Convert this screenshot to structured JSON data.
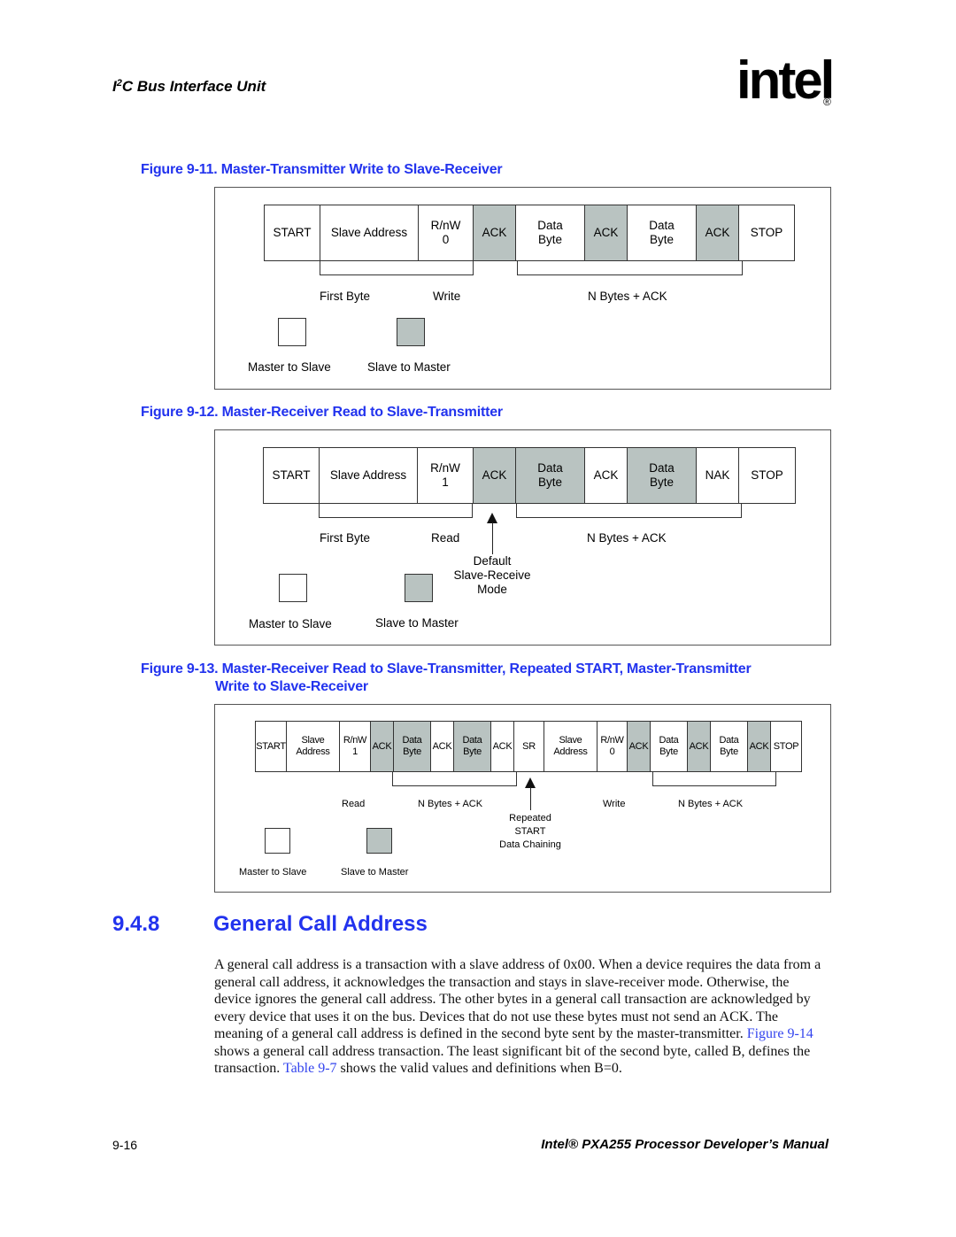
{
  "header": {
    "section_prefix": "I",
    "section_sup": "2",
    "section_suffix": "C Bus Interface Unit",
    "logo_text": "intel",
    "logo_registered": "®"
  },
  "figures": [
    {
      "caption": "Figure 9-11. Master-Transmitter Write to Slave-Receiver",
      "cells": [
        {
          "text": "START",
          "shaded": false
        },
        {
          "text": "Slave Address",
          "shaded": false
        },
        {
          "text": "R/nW\n0",
          "shaded": false
        },
        {
          "text": "ACK",
          "shaded": true
        },
        {
          "text": "Data\nByte",
          "shaded": false
        },
        {
          "text": "ACK",
          "shaded": true
        },
        {
          "text": "Data\nByte",
          "shaded": false
        },
        {
          "text": "ACK",
          "shaded": true
        },
        {
          "text": "STOP",
          "shaded": false
        }
      ],
      "labels": [
        "First Byte",
        "Write",
        "N Bytes + ACK"
      ],
      "legend": [
        "Master to Slave",
        "Slave to Master"
      ]
    },
    {
      "caption": "Figure 9-12. Master-Receiver Read to Slave-Transmitter",
      "cells": [
        {
          "text": "START",
          "shaded": false
        },
        {
          "text": "Slave Address",
          "shaded": false
        },
        {
          "text": "R/nW\n1",
          "shaded": false
        },
        {
          "text": "ACK",
          "shaded": true
        },
        {
          "text": "Data\nByte",
          "shaded": true
        },
        {
          "text": "ACK",
          "shaded": false
        },
        {
          "text": "Data\nByte",
          "shaded": true
        },
        {
          "text": "NAK",
          "shaded": false
        },
        {
          "text": "STOP",
          "shaded": false
        }
      ],
      "labels": [
        "First Byte",
        "Read",
        "N Bytes + ACK"
      ],
      "annotation": "Default\nSlave-Receive\nMode",
      "legend": [
        "Master to Slave",
        "Slave to Master"
      ]
    },
    {
      "caption_line1": "Figure 9-13. Master-Receiver Read to Slave-Transmitter, Repeated START, Master-Transmitter",
      "caption_line2": "Write to Slave-Receiver",
      "cells": [
        {
          "text": "START",
          "shaded": false
        },
        {
          "text": "Slave\nAddress",
          "shaded": false
        },
        {
          "text": "R/nW\n1",
          "shaded": false
        },
        {
          "text": "ACK",
          "shaded": true
        },
        {
          "text": "Data\nByte",
          "shaded": true
        },
        {
          "text": "ACK",
          "shaded": false
        },
        {
          "text": "Data\nByte",
          "shaded": true
        },
        {
          "text": "ACK",
          "shaded": false
        },
        {
          "text": "SR",
          "shaded": false
        },
        {
          "text": "Slave\nAddress",
          "shaded": false
        },
        {
          "text": "R/nW\n0",
          "shaded": false
        },
        {
          "text": "ACK",
          "shaded": true
        },
        {
          "text": "Data\nByte",
          "shaded": false
        },
        {
          "text": "ACK",
          "shaded": true
        },
        {
          "text": "Data\nByte",
          "shaded": false
        },
        {
          "text": "ACK",
          "shaded": true
        },
        {
          "text": "STOP",
          "shaded": false
        }
      ],
      "labels": [
        "Read",
        "N Bytes + ACK",
        "Write",
        "N Bytes + ACK"
      ],
      "annotation": "Repeated\nSTART\nData Chaining",
      "legend": [
        "Master to Slave",
        "Slave to Master"
      ]
    }
  ],
  "section": {
    "number": "9.4.8",
    "title": "General Call Address",
    "paragraph": [
      {
        "text": "A general call address is a transaction with a slave address of 0x00. When a device requires the data from a general call address, it acknowledges the transaction and stays in slave-receiver mode. Otherwise, the device ignores the general call address. The other bytes in a general call transaction are acknowledged by every device that uses it on the bus. Devices that do not use these bytes must not send an ACK. The meaning of a general call address is defined in the second byte sent by the master-transmitter. "
      },
      {
        "text": "Figure 9-14",
        "link": true
      },
      {
        "text": " shows a general call address transaction. The least significant bit of the second byte, called B, defines the transaction. "
      },
      {
        "text": "Table 9-7",
        "link": true
      },
      {
        "text": " shows the valid values and definitions when B=0."
      }
    ]
  },
  "footer": {
    "page_number": "9-16",
    "manual_title": "Intel® PXA255 Processor Developer’s Manual"
  }
}
